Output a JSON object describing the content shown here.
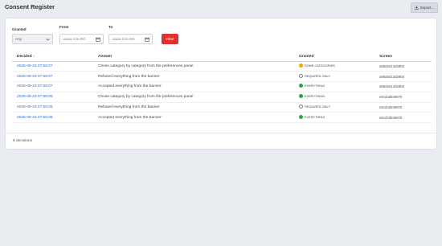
{
  "header": {
    "title": "Consent Register",
    "export_label": "Export..."
  },
  "filters": {
    "granted_label": "Granted",
    "granted_value": "Any",
    "from_label": "From",
    "from_placeholder": "aaaa-mm-DD",
    "to_label": "To",
    "to_placeholder": "aaaa-mm-DD",
    "filter_label": "Filter"
  },
  "table": {
    "columns": [
      "Decided ↓",
      "Answer",
      "Granted",
      "Screen"
    ],
    "rows": [
      {
        "decided": "2026-09-23 07:56:07",
        "answer": "Chose category by category from the preferences panel",
        "granted": "SOME CATEGORIES",
        "status": "some",
        "screen": "a88a5513d29b0"
      },
      {
        "decided": "2026-09-23 07:56:07",
        "answer": "Refused everything from the banner",
        "granted": "REQUIRED ONLY",
        "status": "required",
        "screen": "a88a5513d29b0"
      },
      {
        "decided": "2026-09-23 07:56:07",
        "answer": "Accepted everything from the banner",
        "granted": "EVERYTHING",
        "status": "everything",
        "screen": "a88a5513d29b0"
      },
      {
        "decided": "2026-09-23 07:56:05",
        "answer": "Chose category by category from the preferences panel",
        "granted": "EVERYTHING",
        "status": "everything",
        "screen": "e8cd4d54997b"
      },
      {
        "decided": "2026-09-23 07:56:05",
        "answer": "Refused everything from the banner",
        "granted": "REQUIRED ONLY",
        "status": "required",
        "screen": "e8cd4d54997b"
      },
      {
        "decided": "2026-09-23 07:56:05",
        "answer": "Accepted everything from the banner",
        "granted": "EVERYTHING",
        "status": "everything",
        "screen": "e8cd4d54997b"
      }
    ]
  },
  "footer": {
    "count_text": "6 decisions"
  },
  "colors": {
    "accent": "#e03131",
    "link": "#2f6fd6",
    "some": "#f2a900",
    "everything": "#2e9e4f",
    "required": "#7a7f87"
  },
  "icons": {
    "export": "download-icon",
    "select": "chevron-down-icon",
    "date": "calendar-icon"
  }
}
